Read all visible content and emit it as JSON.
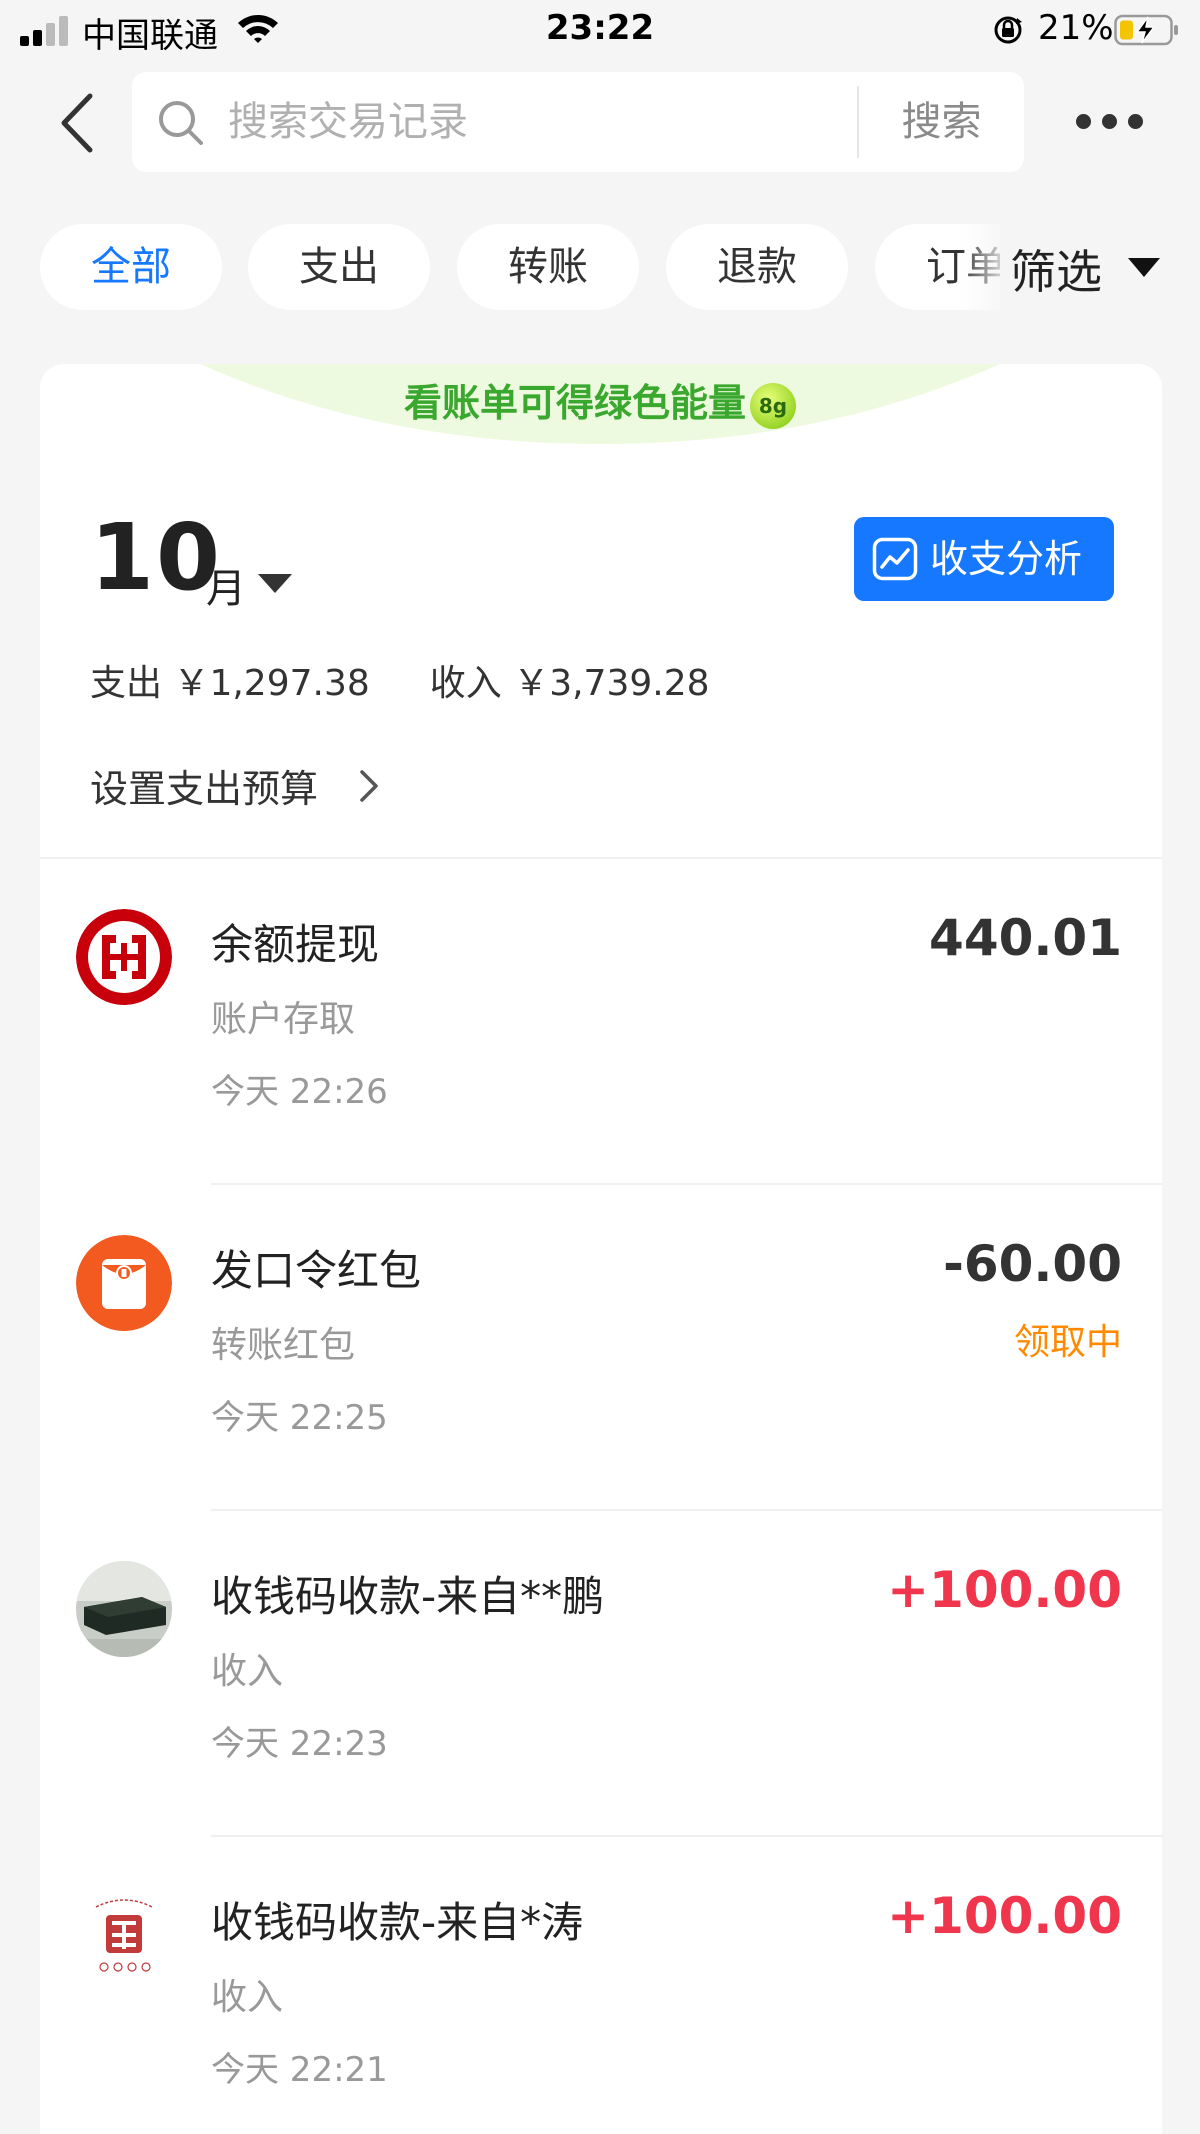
{
  "status_bar": {
    "carrier": "中国联通",
    "time": "23:22",
    "battery_percent": "21%"
  },
  "search": {
    "placeholder": "搜索交易记录",
    "button_label": "搜索"
  },
  "filters": {
    "chips": [
      {
        "label": "全部",
        "active": true
      },
      {
        "label": "支出",
        "active": false
      },
      {
        "label": "转账",
        "active": false
      },
      {
        "label": "退款",
        "active": false
      },
      {
        "label": "订单",
        "active": false
      }
    ],
    "filter_label": "筛选"
  },
  "banner": {
    "text": "看账单可得绿色能量",
    "badge": "8g"
  },
  "month": {
    "number": "10",
    "unit": "月",
    "analysis_label": "收支分析"
  },
  "summary": {
    "expense": "支出 ￥1,297.38",
    "income": "收入 ￥3,739.28"
  },
  "budget": {
    "label": "设置支出预算"
  },
  "transactions": [
    {
      "title": "余额提现",
      "subtitle": "账户存取",
      "time": "今天 22:26",
      "amount": "440.01",
      "status": ""
    },
    {
      "title": "发口令红包",
      "subtitle": "转账红包",
      "time": "今天 22:25",
      "amount": "-60.00",
      "status": "领取中"
    },
    {
      "title": "收钱码收款-来自**鹏",
      "subtitle": "收入",
      "time": "今天 22:23",
      "amount": "+100.00",
      "status": ""
    },
    {
      "title": "收钱码收款-来自*涛",
      "subtitle": "收入",
      "time": "今天 22:21",
      "amount": "+100.00",
      "status": ""
    }
  ],
  "colors": {
    "accent": "#1677ff",
    "positive_amount": "#f0364d",
    "status_pending": "#ff8a00",
    "energy_green": "#3aa82f"
  },
  "icons": {
    "txn_0": "icbc-bank-logo-icon",
    "txn_1": "red-packet-icon",
    "txn_2": "user-avatar-photo",
    "txn_3": "fa-character-avatar"
  }
}
